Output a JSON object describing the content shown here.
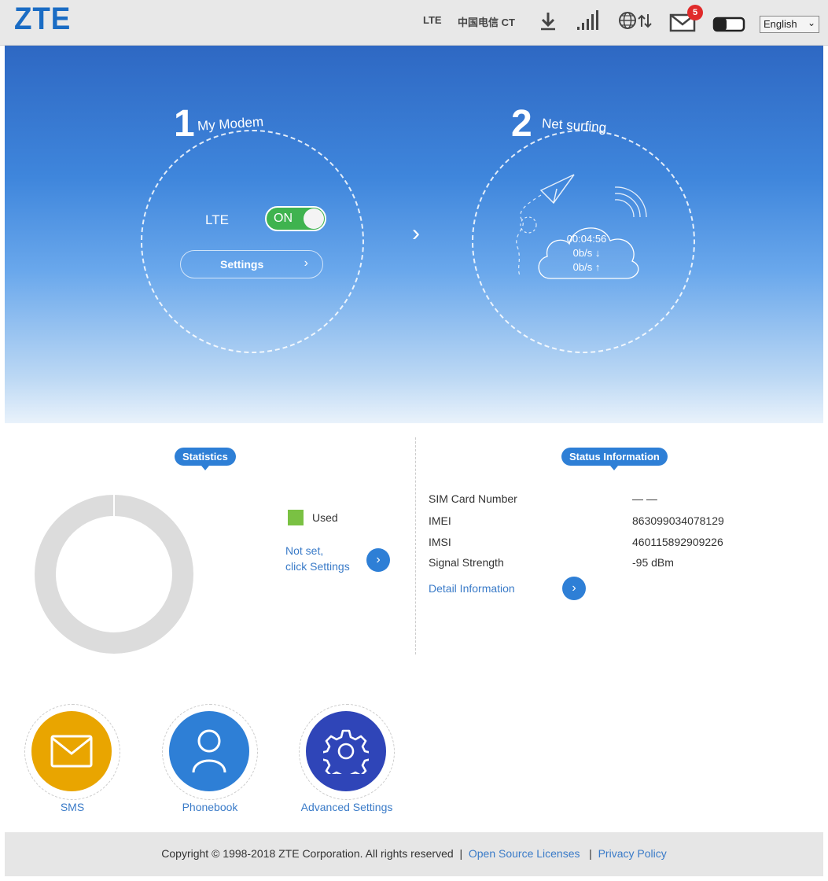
{
  "header": {
    "logo": "ZTE",
    "network_type": "LTE",
    "operator": "中国电信 CT",
    "unread_messages": "5",
    "language": "English"
  },
  "hero": {
    "step1": {
      "number": "1",
      "title": "My Modem",
      "lte_label": "LTE",
      "toggle_label": "ON",
      "settings_label": "Settings"
    },
    "step2": {
      "number": "2",
      "title": "Net surfing",
      "duration": "00:04:56",
      "download_rate": "0b/s ↓",
      "upload_rate": "0b/s ↑"
    }
  },
  "statistics": {
    "tag": "Statistics",
    "legend_used": "Used",
    "notset_line1": "Not set,",
    "notset_line2": "click Settings"
  },
  "status": {
    "tag": "Status Information",
    "rows": [
      {
        "label": "SIM Card Number",
        "value": "— —"
      },
      {
        "label": "IMEI",
        "value": "863099034078129"
      },
      {
        "label": "IMSI",
        "value": "460115892909226"
      },
      {
        "label": "Signal Strength",
        "value": "-95 dBm"
      }
    ],
    "detail_label": "Detail Information"
  },
  "shortcuts": [
    {
      "label": "SMS",
      "color": "#e9a500"
    },
    {
      "label": "Phonebook",
      "color": "#2e7fd6"
    },
    {
      "label": "Advanced Settings",
      "color": "#2f45b8"
    }
  ],
  "footer": {
    "copyright": "Copyright © 1998-2018 ZTE Corporation. All rights reserved",
    "sep": "|",
    "open_source": "Open Source Licenses",
    "privacy": "Privacy Policy"
  },
  "colors": {
    "accent": "#2e7fd6",
    "toggle_on": "#3fb34f",
    "used": "#7ac143"
  }
}
